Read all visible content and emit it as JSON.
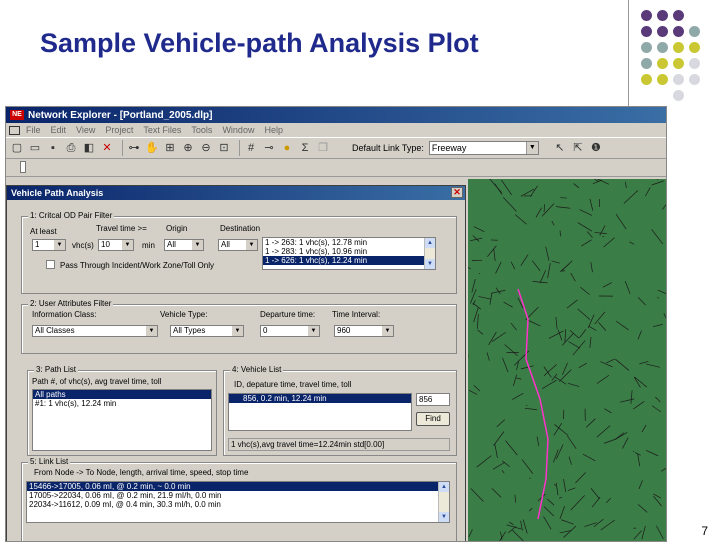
{
  "slide": {
    "title": "Sample Vehicle-path Analysis Plot",
    "page_number": "7",
    "dot_colors": [
      "#5b3a7a",
      "#8fa8a8",
      "#c9c832",
      "#d8d8e0"
    ]
  },
  "app": {
    "title": "Network Explorer - [Portland_2005.dlp]",
    "menu": [
      "File",
      "Edit",
      "View",
      "Project",
      "Text Files",
      "Tools",
      "Window",
      "Help"
    ],
    "toolbar_icons": [
      "new-icon",
      "open-icon",
      "save-icon",
      "print-icon",
      "preview-icon",
      "delete-icon",
      "path-icon",
      "pan-icon",
      "zoom-window-icon",
      "zoom-in-icon",
      "zoom-out-icon",
      "zoom-extent-icon",
      "grid-icon",
      "node-icon",
      "info-icon",
      "sigma-icon",
      "copy-icon",
      "pointer-icon",
      "select-icon",
      "one-icon"
    ],
    "link_type_label": "Default Link Type:",
    "link_type_value": "Freeway"
  },
  "dialog": {
    "title": "Vehicle Path Analysis",
    "od_filter": {
      "group_title": "1: Critcal OD Pair Filter",
      "at_least_label": "At least",
      "at_least_value": "1",
      "vhcs_label": "vhc(s)",
      "travel_time_label": "Travel time >=",
      "travel_time_value": "10",
      "min_label": "min",
      "origin_label": "Origin",
      "origin_value": "All",
      "destination_label": "Destination",
      "destination_value": "All",
      "destination_list": [
        "1 -> 263: 1 vhc(s), 12.78 min",
        "1 -> 283: 1 vhc(s), 10.96 min",
        "1 -> 626: 1 vhc(s), 12.24 min"
      ],
      "destination_selected": 2,
      "pass_through_label": "Pass Through Incident/Work Zone/Toll Only"
    },
    "user_attributes": {
      "group_title": "2: User Attributes Filter",
      "info_class_label": "Information Class:",
      "info_class_value": "All Classes",
      "vehicle_type_label": "Vehicle Type:",
      "vehicle_type_value": "All Types",
      "departure_label": "Departure time:",
      "departure_value": "0",
      "interval_label": "Time Interval:",
      "interval_value": "960"
    },
    "path_list": {
      "group_title": "3: Path List",
      "header": "Path #, of vhc(s), avg travel time, toll",
      "items": [
        "All paths",
        "#1: 1 vhc(s), 12.24 min"
      ],
      "selected": 0
    },
    "vehicle_list": {
      "group_title": "4: Vehicle List",
      "header": "ID, depature time, travel time, toll",
      "items": [
        "856,  0.2 min, 12.24 min"
      ],
      "selected": 0,
      "find_value": "856",
      "find_label": "Find",
      "status": "1 vhc(s),avg travel time=12.24min std[0.00]"
    },
    "link_list": {
      "group_title": "5: Link List",
      "header": "From Node -> To Node, length, arrival time, speed, stop time",
      "items": [
        "15466->17005, 0.06 mI, @ 0.2 min, ~  0.0 min",
        "17005->22034, 0.06 mI, @  0.2 min,  21.9 mI/h,  0.0 min",
        "22034->11612, 0.09 mI, @  0.4 min,  30.3 mI/h,  0.0 min"
      ],
      "selected": 0
    }
  }
}
